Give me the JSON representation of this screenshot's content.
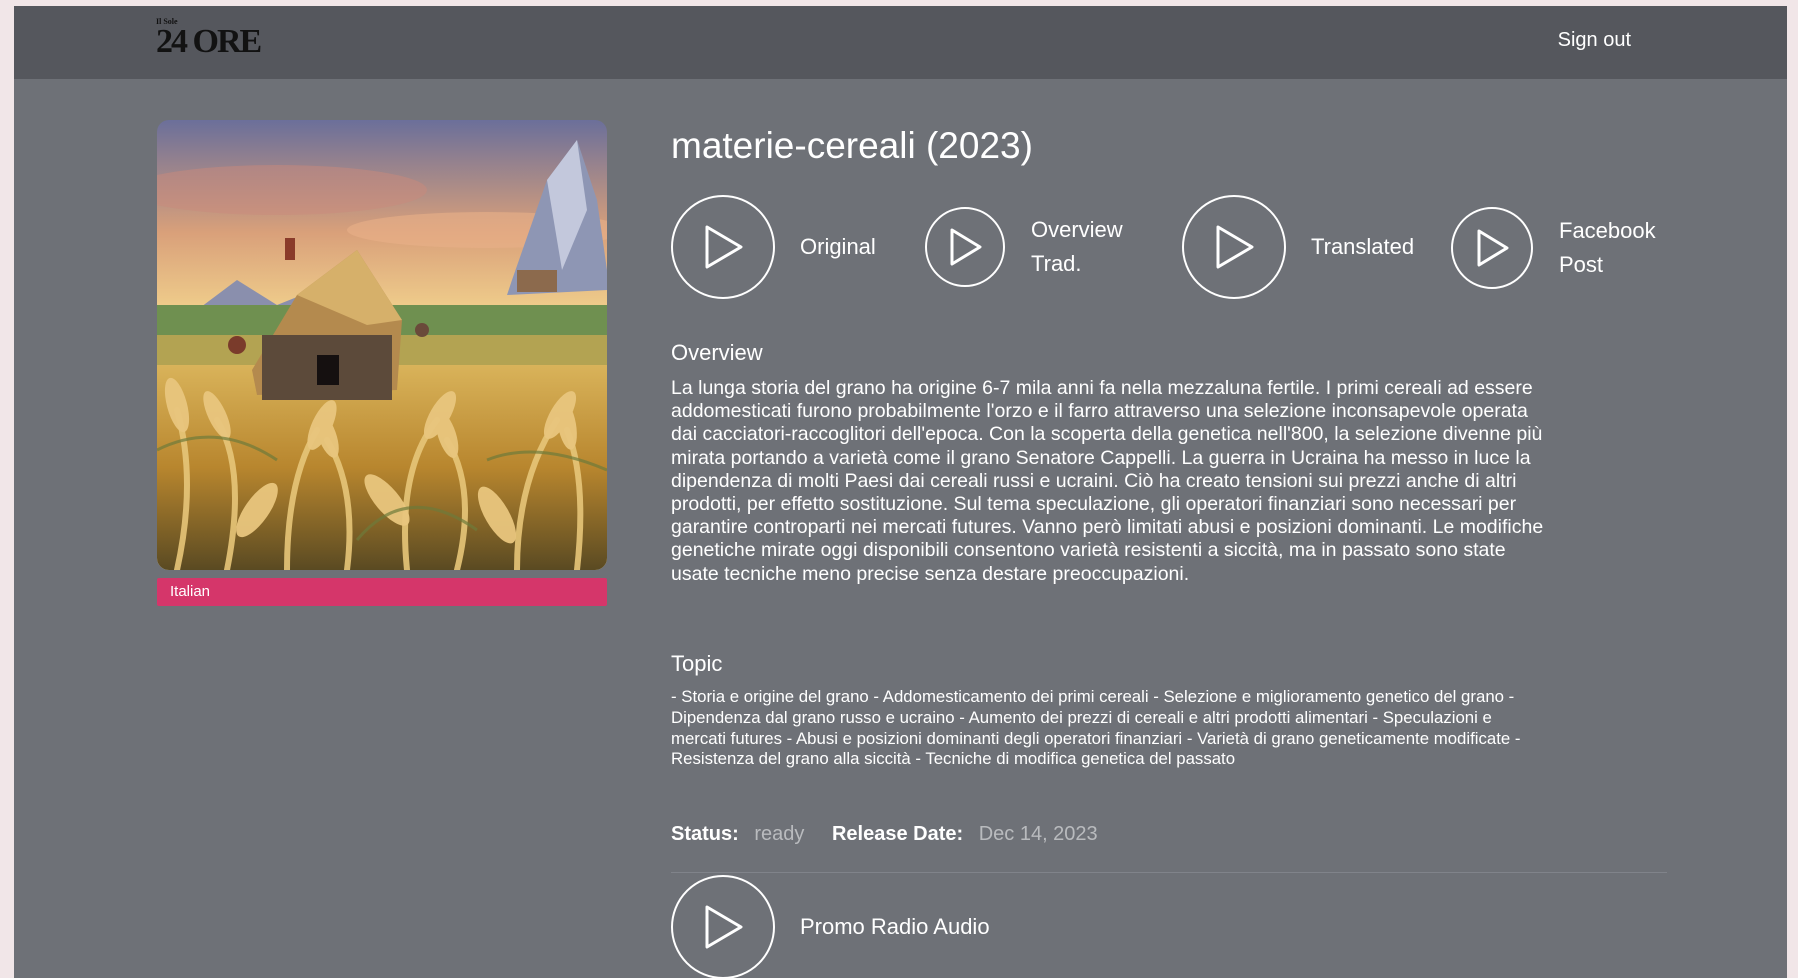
{
  "header": {
    "logo_small": "Il Sole",
    "logo_big": "24 ORE",
    "sign_out": "Sign out"
  },
  "cover": {
    "language_badge": "Italian",
    "badge_color": "#d5366a"
  },
  "episode": {
    "title": "materie-cereali (2023)",
    "players": [
      {
        "label": "Original",
        "icon": "play-icon"
      },
      {
        "label": "Overview Trad.",
        "label_line1": "Overview",
        "label_line2": "Trad.",
        "icon": "play-icon"
      },
      {
        "label": "Translated",
        "icon": "play-icon"
      },
      {
        "label": "Facebook Post",
        "label_line1": "Facebook",
        "label_line2": "Post",
        "icon": "play-icon"
      }
    ],
    "overview_heading": "Overview",
    "overview_text": "La lunga storia del grano ha origine 6-7 mila anni fa nella mezzaluna fertile. I primi cereali ad essere addomesticati furono probabilmente l'orzo e il farro attraverso una selezione inconsapevole operata dai cacciatori-raccoglitori dell'epoca. Con la scoperta della genetica nell'800, la selezione divenne più mirata portando a varietà come il grano Senatore Cappelli. La guerra in Ucraina ha messo in luce la dipendenza di molti Paesi dai cereali russi e ucraini. Ciò ha creato tensioni sui prezzi anche di altri prodotti, per effetto sostituzione. Sul tema speculazione, gli operatori finanziari sono necessari per garantire controparti nei mercati futures. Vanno però limitati abusi e posizioni dominanti. Le modifiche genetiche mirate oggi disponibili consentono varietà resistenti a siccità, ma in passato sono state usate tecniche meno precise senza destare preoccupazioni.",
    "topic_heading": "Topic",
    "topic_text": "- Storia e origine del grano - Addomesticamento dei primi cereali - Selezione e miglioramento genetico del grano - Dipendenza dal grano russo e ucraino - Aumento dei prezzi di cereali e altri prodotti alimentari - Speculazioni e mercati futures - Abusi e posizioni dominanti degli operatori finanziari - Varietà di grano geneticamente modificate - Resistenza del grano alla siccità - Tecniche di modifica genetica del passato",
    "status_label": "Status:",
    "status_value": "ready",
    "release_label": "Release Date:",
    "release_value": "Dec 14, 2023",
    "promo_label": "Promo Radio Audio"
  }
}
